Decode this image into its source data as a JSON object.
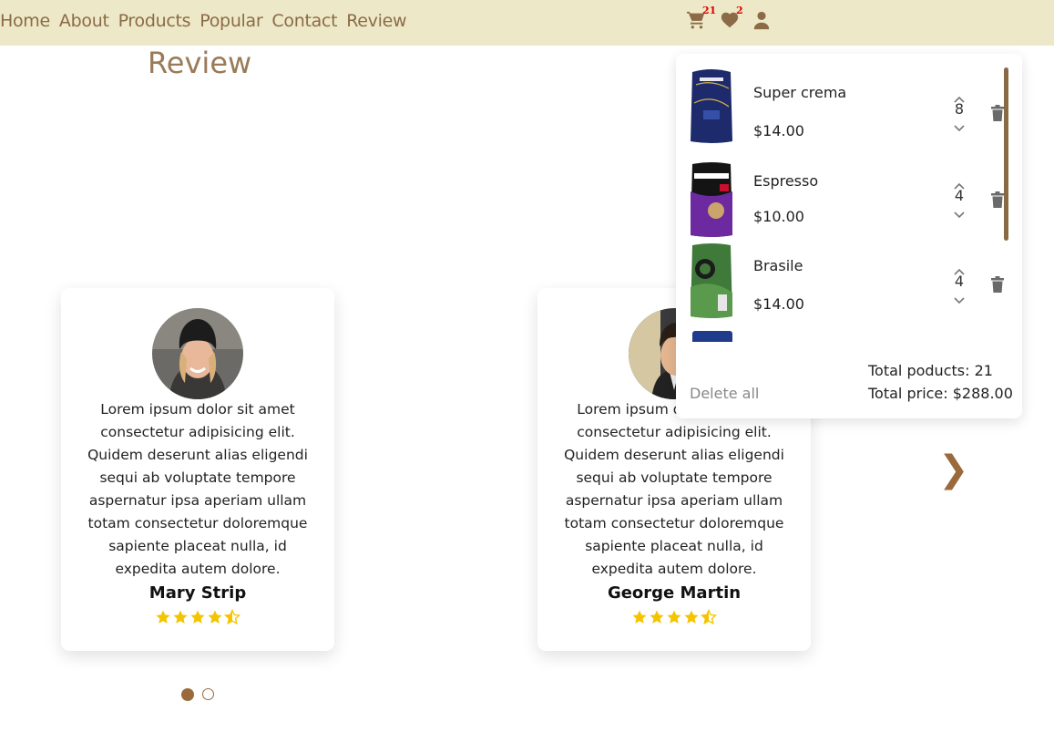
{
  "nav": {
    "links": [
      "Home",
      "About",
      "Products",
      "Popular",
      "Contact",
      "Review"
    ],
    "cart_icon": "cart-icon",
    "cart_count": "21",
    "wishlist_icon": "heart-icon",
    "wishlist_count": "2",
    "user_icon": "user-icon"
  },
  "review_section": {
    "title": "Review",
    "next_arrow": "❯",
    "reviews": [
      {
        "text": "Lorem ipsum dolor sit amet consectetur adipisicing elit. Quidem deserunt alias eligendi sequi ab voluptate tempore aspernatur ipsa aperiam ullam totam consectetur doloremque sapiente placeat nulla, id expedita autem dolore.",
        "name": "Mary Strip",
        "rating": 4.5
      },
      {
        "text": "Lorem ipsum dolor sit amet consectetur adipisicing elit. Quidem deserunt alias eligendi sequi ab voluptate tempore aspernatur ipsa aperiam ullam totam consectetur doloremque sapiente placeat nulla, id expedita autem dolore.",
        "name": "George Martin",
        "rating": 4.5
      }
    ],
    "active_page": 1,
    "page_count": 2
  },
  "cart": {
    "items": [
      {
        "name": "Super crema",
        "price": "$14.00",
        "qty": "8"
      },
      {
        "name": "Espresso",
        "price": "$10.00",
        "qty": "4"
      },
      {
        "name": "Brasile",
        "price": "$14.00",
        "qty": "4"
      }
    ],
    "delete_all": "Delete all",
    "total_products": "Total poducts: 21",
    "total_price": "Total price: $288.00"
  },
  "colors": {
    "navbar_bg": "#ede9c8",
    "brand_brown": "#8c6a46",
    "star": "#f5c400",
    "badge_red": "#e00000"
  }
}
